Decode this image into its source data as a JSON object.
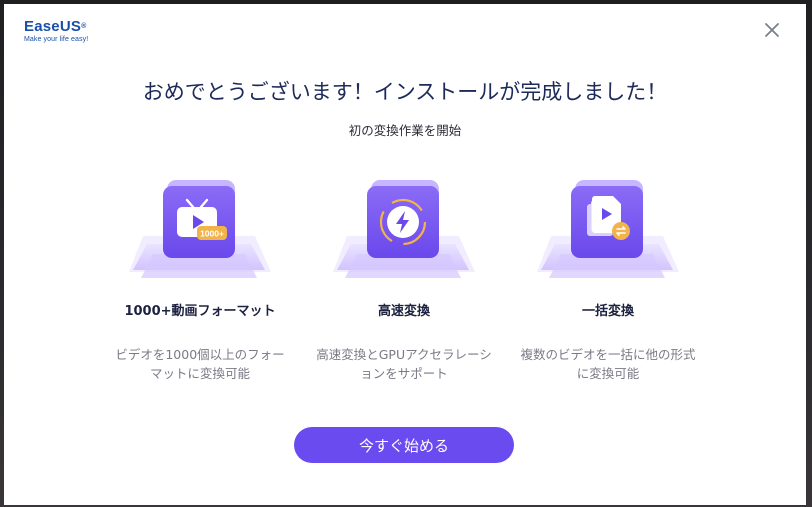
{
  "brand": {
    "name_part1": "Ease",
    "name_part2": "US",
    "registered": "®",
    "tagline": "Make your life easy!"
  },
  "dialog": {
    "title": "おめでとうございます！インストールが完成しました！",
    "subtitle": "初の変換作業を開始"
  },
  "features": [
    {
      "icon": "tv-play-icon",
      "badge": "1000+",
      "name": "1000+動画フォーマット",
      "desc_line1": "ビデオを1000個以上のフォー",
      "desc_line2": "マットに変換可能"
    },
    {
      "icon": "lightning-refresh-icon",
      "name": "高速変換",
      "desc_line1": "高速変換とGPUアクセラレーシ",
      "desc_line2": "ョンをサポート"
    },
    {
      "icon": "batch-files-icon",
      "name": "一括変換",
      "desc_line1": "複数のビデオを一括に他の形式",
      "desc_line2": "に変換可能"
    }
  ],
  "actions": {
    "start_label": "今すぐ始める"
  },
  "colors": {
    "accent": "#6a4bf0",
    "title": "#1d2a5a",
    "brand": "#1b4fa8"
  }
}
